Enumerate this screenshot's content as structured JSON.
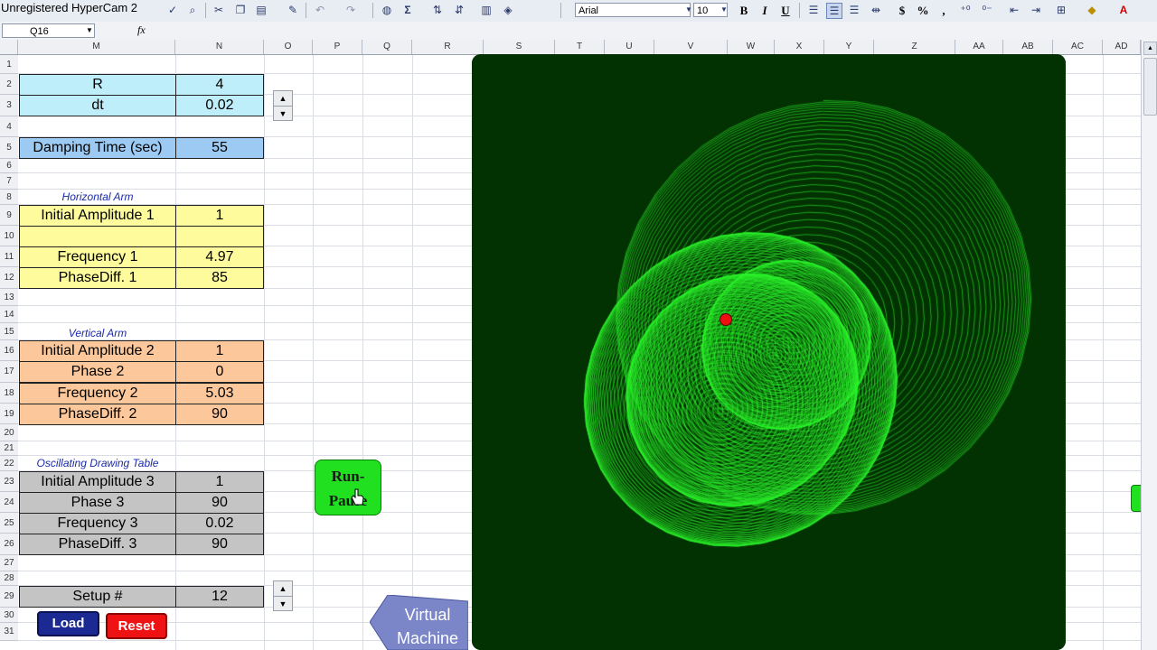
{
  "app": {
    "watermark": "Unregistered HyperCam 2",
    "font_name": "Arial",
    "font_size": "10",
    "name_box": "Q16",
    "fx_label": "fx"
  },
  "toolbar": {
    "bold": "B",
    "italic": "I",
    "underline": "U",
    "currency": "$",
    "percent": "%",
    "comma": ",",
    "sum": "Σ"
  },
  "columns": [
    "M",
    "N",
    "O",
    "P",
    "Q",
    "R",
    "S",
    "T",
    "U",
    "V",
    "W",
    "X",
    "Y",
    "Z",
    "AA",
    "AB",
    "AC",
    "AD"
  ],
  "rows": [
    "1",
    "2",
    "3",
    "4",
    "5",
    "6",
    "7",
    "8",
    "9",
    "10",
    "11",
    "12",
    "13",
    "14",
    "15",
    "16",
    "17",
    "18",
    "19",
    "20",
    "21",
    "22",
    "23",
    "24",
    "25",
    "26",
    "27",
    "28",
    "29",
    "30",
    "31"
  ],
  "params": {
    "R": {
      "label": "R",
      "value": "4"
    },
    "dt": {
      "label": "dt",
      "value": "0.02"
    },
    "damping": {
      "label": "Damping Time (sec)",
      "value": "55"
    }
  },
  "horizontal_arm": {
    "title": "Horizontal Arm",
    "amp1": {
      "label": "Initial Amplitude 1",
      "value": "1"
    },
    "freq1": {
      "label": "Frequency 1",
      "value": "4.97"
    },
    "phase1": {
      "label": "PhaseDiff. 1",
      "value": "85"
    }
  },
  "vertical_arm": {
    "title": "Vertical Arm",
    "amp2": {
      "label": "Initial Amplitude 2",
      "value": "1"
    },
    "phase2": {
      "label": "Phase 2",
      "value": "0"
    },
    "freq2": {
      "label": "Frequency 2",
      "value": "5.03"
    },
    "phasediff2": {
      "label": "PhaseDiff. 2",
      "value": "90"
    }
  },
  "table": {
    "title": "Oscillating Drawing Table",
    "amp3": {
      "label": "Initial Amplitude 3",
      "value": "1"
    },
    "phase3": {
      "label": "Phase 3",
      "value": "90"
    },
    "freq3": {
      "label": "Frequency 3",
      "value": "0.02"
    },
    "phasediff3": {
      "label": "PhaseDiff. 3",
      "value": "90"
    }
  },
  "setup": {
    "label": "Setup #",
    "value": "12"
  },
  "buttons": {
    "run_line1": "Run-",
    "run_line2": "Pause",
    "load": "Load",
    "reset": "Reset",
    "vm_line1": "Virtual",
    "vm_line2": "Machine"
  },
  "colors": {
    "plot_background": "#033202",
    "trace": "#2af52a",
    "pen_dot": "#ee1010"
  }
}
